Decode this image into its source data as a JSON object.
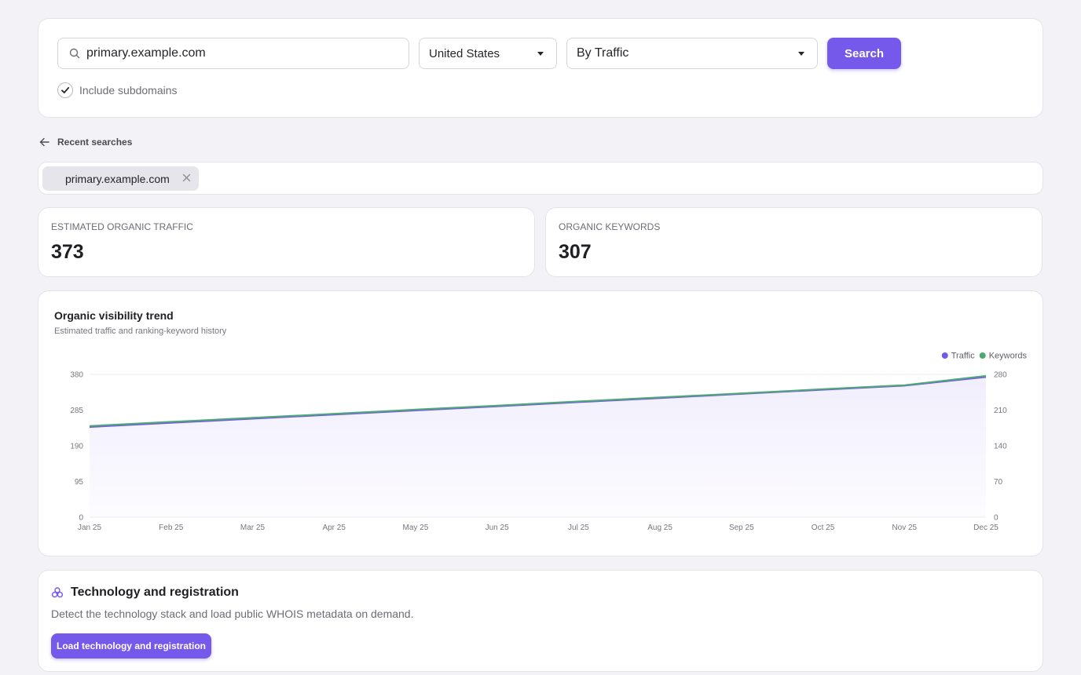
{
  "search": {
    "domain_value": "primary.example.com",
    "country": "United States",
    "sort_by": "By Traffic",
    "button_label": "Search",
    "include_subdomains_label": "Include subdomains",
    "include_subdomains_checked": true
  },
  "recent": {
    "label": "Recent searches",
    "items": [
      {
        "label": "primary.example.com"
      }
    ]
  },
  "metrics": [
    {
      "label": "ESTIMATED ORGANIC TRAFFIC",
      "value": "373"
    },
    {
      "label": "ORGANIC KEYWORDS",
      "value": "307"
    }
  ],
  "chart": {
    "title": "Organic visibility trend",
    "subtitle": "Estimated traffic and ranking-keyword history"
  },
  "chart_data": {
    "type": "line",
    "x": [
      "Jan 25",
      "Feb 25",
      "Mar 25",
      "Apr 25",
      "May 25",
      "Jun 25",
      "Jul 25",
      "Aug 25",
      "Sep 25",
      "Oct 25",
      "Nov 25",
      "Dec 25"
    ],
    "series": [
      {
        "name": "Traffic",
        "axis": "left",
        "color": "#7459ea",
        "area": true,
        "values": [
          240,
          251,
          262,
          273,
          284,
          295,
          306,
          317,
          328,
          339,
          350,
          373
        ]
      },
      {
        "name": "Keywords",
        "axis": "right",
        "color": "#4caa72",
        "values": [
          179,
          187,
          195,
          203,
          211,
          219,
          227,
          235,
          243,
          251,
          259,
          277
        ]
      }
    ],
    "yleft_ticks": [
      "0",
      "95",
      "190",
      "285",
      "380"
    ],
    "yright_ticks": [
      "0",
      "70",
      "140",
      "210",
      "280"
    ],
    "yleft_range": [
      0,
      380
    ],
    "yright_range": [
      0,
      280
    ],
    "legend_position": "top-right",
    "grid": true
  },
  "tech": {
    "title": "Technology and registration",
    "description": "Detect the technology stack and load public WHOIS metadata on demand.",
    "button_label": "Load technology and registration"
  },
  "colors": {
    "accent": "#7459ea",
    "keywords_line": "#4caa72",
    "background": "#f3f2f7"
  }
}
